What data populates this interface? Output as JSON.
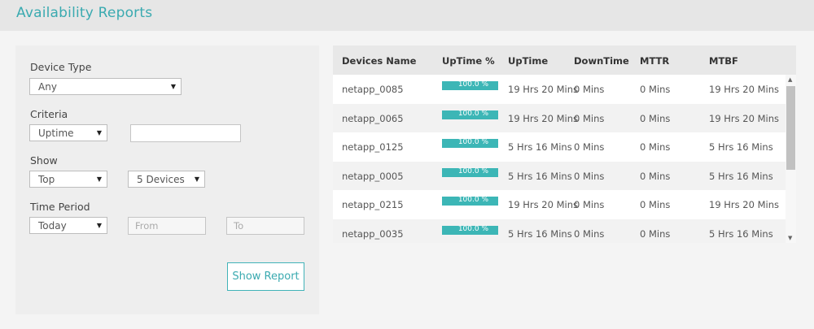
{
  "header": {
    "title": "Availability Reports"
  },
  "filters": {
    "device_type": {
      "label": "Device Type",
      "value": "Any"
    },
    "criteria": {
      "label": "Criteria",
      "value": "Uptime",
      "input_value": ""
    },
    "show": {
      "label": "Show",
      "value": "Top",
      "count": "5 Devices"
    },
    "time_period": {
      "label": "Time Period",
      "value": "Today",
      "from_placeholder": "From",
      "to_placeholder": "To"
    },
    "show_report_label": "Show Report"
  },
  "table": {
    "columns": [
      "Devices Name",
      "UpTime %",
      "UpTime",
      "DownTime",
      "MTTR",
      "MTBF"
    ],
    "rows": [
      {
        "name": "netapp_0085",
        "uptime_pct": 100.0,
        "uptime_pct_label": "100.0 %",
        "uptime": "19 Hrs 20 Mins",
        "downtime": "0 Mins",
        "mttr": "0 Mins",
        "mtbf": "19 Hrs 20 Mins"
      },
      {
        "name": "netapp_0065",
        "uptime_pct": 100.0,
        "uptime_pct_label": "100.0 %",
        "uptime": "19 Hrs 20 Mins",
        "downtime": "0 Mins",
        "mttr": "0 Mins",
        "mtbf": "19 Hrs 20 Mins"
      },
      {
        "name": "netapp_0125",
        "uptime_pct": 100.0,
        "uptime_pct_label": "100.0 %",
        "uptime": "5 Hrs 16 Mins",
        "downtime": "0 Mins",
        "mttr": "0 Mins",
        "mtbf": "5 Hrs 16 Mins"
      },
      {
        "name": "netapp_0005",
        "uptime_pct": 100.0,
        "uptime_pct_label": "100.0 %",
        "uptime": "5 Hrs 16 Mins",
        "downtime": "0 Mins",
        "mttr": "0 Mins",
        "mtbf": "5 Hrs 16 Mins"
      },
      {
        "name": "netapp_0215",
        "uptime_pct": 100.0,
        "uptime_pct_label": "100.0 %",
        "uptime": "19 Hrs 20 Mins",
        "downtime": "0 Mins",
        "mttr": "0 Mins",
        "mtbf": "19 Hrs 20 Mins"
      },
      {
        "name": "netapp_0035",
        "uptime_pct": 100.0,
        "uptime_pct_label": "100.0 %",
        "uptime": "5 Hrs 16 Mins",
        "downtime": "0 Mins",
        "mttr": "0 Mins",
        "mtbf": "5 Hrs 16 Mins"
      }
    ]
  },
  "icons": {
    "dropdown": "caret-down-icon",
    "scroll_up": "scroll-up-icon",
    "scroll_down": "scroll-down-icon"
  },
  "colors": {
    "accent": "#3aaab0",
    "bar": "#3cb6b6"
  }
}
